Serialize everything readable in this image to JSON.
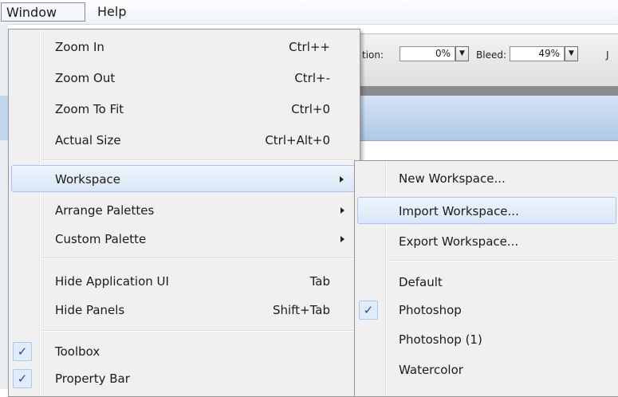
{
  "menubar": {
    "window_label": "Window",
    "help_label": "Help"
  },
  "property_bar": {
    "rotation_label": "tion:",
    "rotation_value": "0%",
    "bleed_label": "Bleed:",
    "bleed_value": "49%",
    "cut_label": "J"
  },
  "window_menu": {
    "items": [
      {
        "label": "Zoom In",
        "shortcut": "Ctrl++"
      },
      {
        "label": "Zoom Out",
        "shortcut": "Ctrl+-"
      },
      {
        "label": "Zoom To Fit",
        "shortcut": "Ctrl+0"
      },
      {
        "label": "Actual Size",
        "shortcut": "Ctrl+Alt+0"
      },
      {
        "label": "Workspace",
        "submenu": true,
        "highlighted": true
      },
      {
        "label": "Arrange Palettes",
        "submenu": true
      },
      {
        "label": "Custom Palette",
        "submenu": true
      },
      {
        "label": "Hide Application UI",
        "shortcut": "Tab"
      },
      {
        "label": "Hide Panels",
        "shortcut": "Shift+Tab"
      },
      {
        "label": "Toolbox",
        "checked": true
      },
      {
        "label": "Property Bar",
        "checked": true
      }
    ]
  },
  "workspace_submenu": {
    "items": [
      {
        "label": "New Workspace..."
      },
      {
        "label": "Import Workspace...",
        "highlighted": true
      },
      {
        "label": "Export Workspace..."
      },
      {
        "label": "Default"
      },
      {
        "label": "Photoshop",
        "checked": true
      },
      {
        "label": "Photoshop (1)"
      },
      {
        "label": "Watercolor"
      }
    ]
  },
  "icons": {
    "check": "checkmark-icon",
    "submenu_arrow": "submenu-arrow-icon",
    "dropdown": "dropdown-arrow-icon"
  },
  "colors": {
    "highlight_border": "#a8c6ec",
    "highlight_fill": "#dae7f7",
    "check_color": "#1e4c9c"
  }
}
